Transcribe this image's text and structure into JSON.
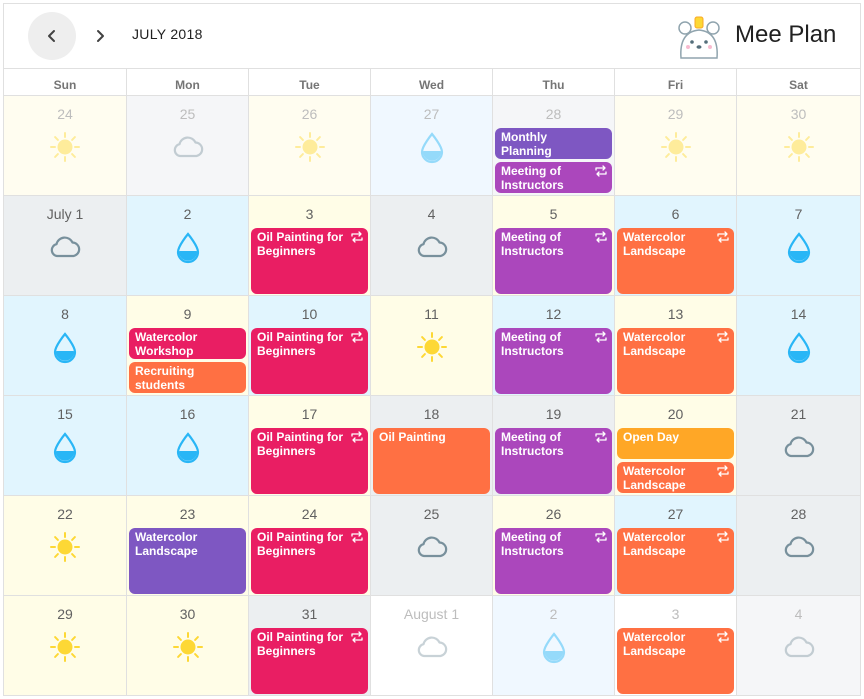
{
  "header": {
    "month_title": "JULY 2018",
    "app_name": "Mee Plan",
    "prev_icon": "chevron-left-icon",
    "next_icon": "chevron-right-icon",
    "logo_icon": "bear-mascot-logo"
  },
  "weekdays": [
    "Sun",
    "Mon",
    "Tue",
    "Wed",
    "Thu",
    "Fri",
    "Sat"
  ],
  "colors": {
    "sunny_bg": "#fffde7",
    "rainy_bg": "#e1f5fe",
    "cloudy_bg": "#eceff1",
    "faded_rainy_bg": "#f0f8ff",
    "faded_cloudy_bg": "#f5f6f8",
    "faded_sunny_bg": "#fffdf0",
    "plain_bg": "#ffffff",
    "sun": "#fdd835",
    "drop": "#29b6f6",
    "cloud": "#78909c",
    "pink": "#e91e63",
    "purple": "#ab47bc",
    "deep_purple": "#7e57c2",
    "orange": "#ff7043",
    "amber": "#ffa726"
  },
  "weeks": [
    [
      {
        "label": "24",
        "out": true,
        "weather": "sun",
        "bg": "faded_sunny_bg",
        "events": []
      },
      {
        "label": "25",
        "out": true,
        "weather": "cloud",
        "bg": "faded_cloudy_bg",
        "events": []
      },
      {
        "label": "26",
        "out": true,
        "weather": "sun",
        "bg": "faded_sunny_bg",
        "events": []
      },
      {
        "label": "27",
        "out": true,
        "weather": "drop",
        "bg": "faded_rainy_bg",
        "events": []
      },
      {
        "label": "28",
        "out": true,
        "weather": "none",
        "bg": "faded_cloudy_bg",
        "events": [
          {
            "title": "Monthly Planning",
            "color": "deep_purple",
            "repeat": false,
            "lines": 1
          },
          {
            "title": "Meeting of Instructors",
            "color": "purple",
            "repeat": true,
            "lines": 2
          }
        ]
      },
      {
        "label": "29",
        "out": true,
        "weather": "sun",
        "bg": "faded_sunny_bg",
        "events": []
      },
      {
        "label": "30",
        "out": true,
        "weather": "sun",
        "bg": "faded_sunny_bg",
        "events": []
      }
    ],
    [
      {
        "label": "July 1",
        "out": false,
        "weather": "cloud",
        "bg": "cloudy_bg",
        "events": []
      },
      {
        "label": "2",
        "out": false,
        "weather": "drop",
        "bg": "rainy_bg",
        "events": []
      },
      {
        "label": "3",
        "out": false,
        "weather": "none",
        "bg": "sunny_bg",
        "events": [
          {
            "title": "Oil Painting for Beginners",
            "color": "pink",
            "repeat": true,
            "lines": 4
          }
        ]
      },
      {
        "label": "4",
        "out": false,
        "weather": "cloud",
        "bg": "cloudy_bg",
        "events": []
      },
      {
        "label": "5",
        "out": false,
        "weather": "none",
        "bg": "sunny_bg",
        "events": [
          {
            "title": "Meeting of Instructors",
            "color": "purple",
            "repeat": true,
            "lines": 4
          }
        ]
      },
      {
        "label": "6",
        "out": false,
        "weather": "none",
        "bg": "rainy_bg",
        "events": [
          {
            "title": "Watercolor Landscape",
            "color": "orange",
            "repeat": true,
            "lines": 4
          }
        ]
      },
      {
        "label": "7",
        "out": false,
        "weather": "drop",
        "bg": "rainy_bg",
        "events": []
      }
    ],
    [
      {
        "label": "8",
        "out": false,
        "weather": "drop",
        "bg": "rainy_bg",
        "events": []
      },
      {
        "label": "9",
        "out": false,
        "weather": "none",
        "bg": "sunny_bg",
        "events": [
          {
            "title": "Watercolor Workshop",
            "color": "pink",
            "repeat": false,
            "lines": 2
          },
          {
            "title": "Recruiting students",
            "color": "orange",
            "repeat": false,
            "lines": 2
          }
        ]
      },
      {
        "label": "10",
        "out": false,
        "weather": "none",
        "bg": "rainy_bg",
        "events": [
          {
            "title": "Oil Painting for Beginners",
            "color": "pink",
            "repeat": true,
            "lines": 4
          }
        ]
      },
      {
        "label": "11",
        "out": false,
        "weather": "sun",
        "bg": "sunny_bg",
        "events": []
      },
      {
        "label": "12",
        "out": false,
        "weather": "none",
        "bg": "rainy_bg",
        "events": [
          {
            "title": "Meeting of Instructors",
            "color": "purple",
            "repeat": true,
            "lines": 4
          }
        ]
      },
      {
        "label": "13",
        "out": false,
        "weather": "none",
        "bg": "sunny_bg",
        "events": [
          {
            "title": "Watercolor Landscape",
            "color": "orange",
            "repeat": true,
            "lines": 4
          }
        ]
      },
      {
        "label": "14",
        "out": false,
        "weather": "drop",
        "bg": "rainy_bg",
        "events": []
      }
    ],
    [
      {
        "label": "15",
        "out": false,
        "weather": "drop",
        "bg": "rainy_bg",
        "events": []
      },
      {
        "label": "16",
        "out": false,
        "weather": "drop",
        "bg": "rainy_bg",
        "events": []
      },
      {
        "label": "17",
        "out": false,
        "weather": "none",
        "bg": "sunny_bg",
        "events": [
          {
            "title": "Oil Painting for Beginners",
            "color": "pink",
            "repeat": true,
            "lines": 4
          }
        ]
      },
      {
        "label": "18",
        "out": false,
        "weather": "none",
        "bg": "cloudy_bg",
        "events": [
          {
            "title": "Oil Painting",
            "color": "orange",
            "repeat": false,
            "lines": 4
          }
        ]
      },
      {
        "label": "19",
        "out": false,
        "weather": "none",
        "bg": "cloudy_bg",
        "events": [
          {
            "title": "Meeting of Instructors",
            "color": "purple",
            "repeat": true,
            "lines": 4
          }
        ]
      },
      {
        "label": "20",
        "out": false,
        "weather": "none",
        "bg": "sunny_bg",
        "events": [
          {
            "title": "Open Day",
            "color": "amber",
            "repeat": false,
            "lines": 1
          },
          {
            "title": "Watercolor Landscape",
            "color": "orange",
            "repeat": true,
            "lines": 2
          }
        ]
      },
      {
        "label": "21",
        "out": false,
        "weather": "cloud",
        "bg": "cloudy_bg",
        "events": []
      }
    ],
    [
      {
        "label": "22",
        "out": false,
        "weather": "sun",
        "bg": "sunny_bg",
        "events": []
      },
      {
        "label": "23",
        "out": false,
        "weather": "none",
        "bg": "sunny_bg",
        "events": [
          {
            "title": "Watercolor Landscape",
            "color": "deep_purple",
            "repeat": false,
            "lines": 4
          }
        ]
      },
      {
        "label": "24",
        "out": false,
        "weather": "none",
        "bg": "sunny_bg",
        "events": [
          {
            "title": "Oil Painting for Beginners",
            "color": "pink",
            "repeat": true,
            "lines": 4
          }
        ]
      },
      {
        "label": "25",
        "out": false,
        "weather": "cloud",
        "bg": "cloudy_bg",
        "events": []
      },
      {
        "label": "26",
        "out": false,
        "weather": "none",
        "bg": "sunny_bg",
        "events": [
          {
            "title": "Meeting of Instructors",
            "color": "purple",
            "repeat": true,
            "lines": 4
          }
        ]
      },
      {
        "label": "27",
        "out": false,
        "weather": "none",
        "bg": "rainy_bg",
        "events": [
          {
            "title": "Watercolor Landscape",
            "color": "orange",
            "repeat": true,
            "lines": 4
          }
        ]
      },
      {
        "label": "28",
        "out": false,
        "weather": "cloud",
        "bg": "cloudy_bg",
        "events": []
      }
    ],
    [
      {
        "label": "29",
        "out": false,
        "weather": "sun",
        "bg": "sunny_bg",
        "events": []
      },
      {
        "label": "30",
        "out": false,
        "weather": "sun",
        "bg": "sunny_bg",
        "events": []
      },
      {
        "label": "31",
        "out": false,
        "weather": "none",
        "bg": "cloudy_bg",
        "events": [
          {
            "title": "Oil Painting for Beginners",
            "color": "pink",
            "repeat": true,
            "lines": 4
          }
        ]
      },
      {
        "label": "August 1",
        "out": true,
        "weather": "cloud",
        "bg": "plain_bg",
        "events": []
      },
      {
        "label": "2",
        "out": true,
        "weather": "drop",
        "bg": "faded_rainy_bg",
        "events": []
      },
      {
        "label": "3",
        "out": true,
        "weather": "none",
        "bg": "plain_bg",
        "events": [
          {
            "title": "Watercolor Landscape",
            "color": "orange",
            "repeat": true,
            "lines": 4
          }
        ]
      },
      {
        "label": "4",
        "out": true,
        "weather": "cloud",
        "bg": "faded_cloudy_bg",
        "events": []
      }
    ]
  ]
}
